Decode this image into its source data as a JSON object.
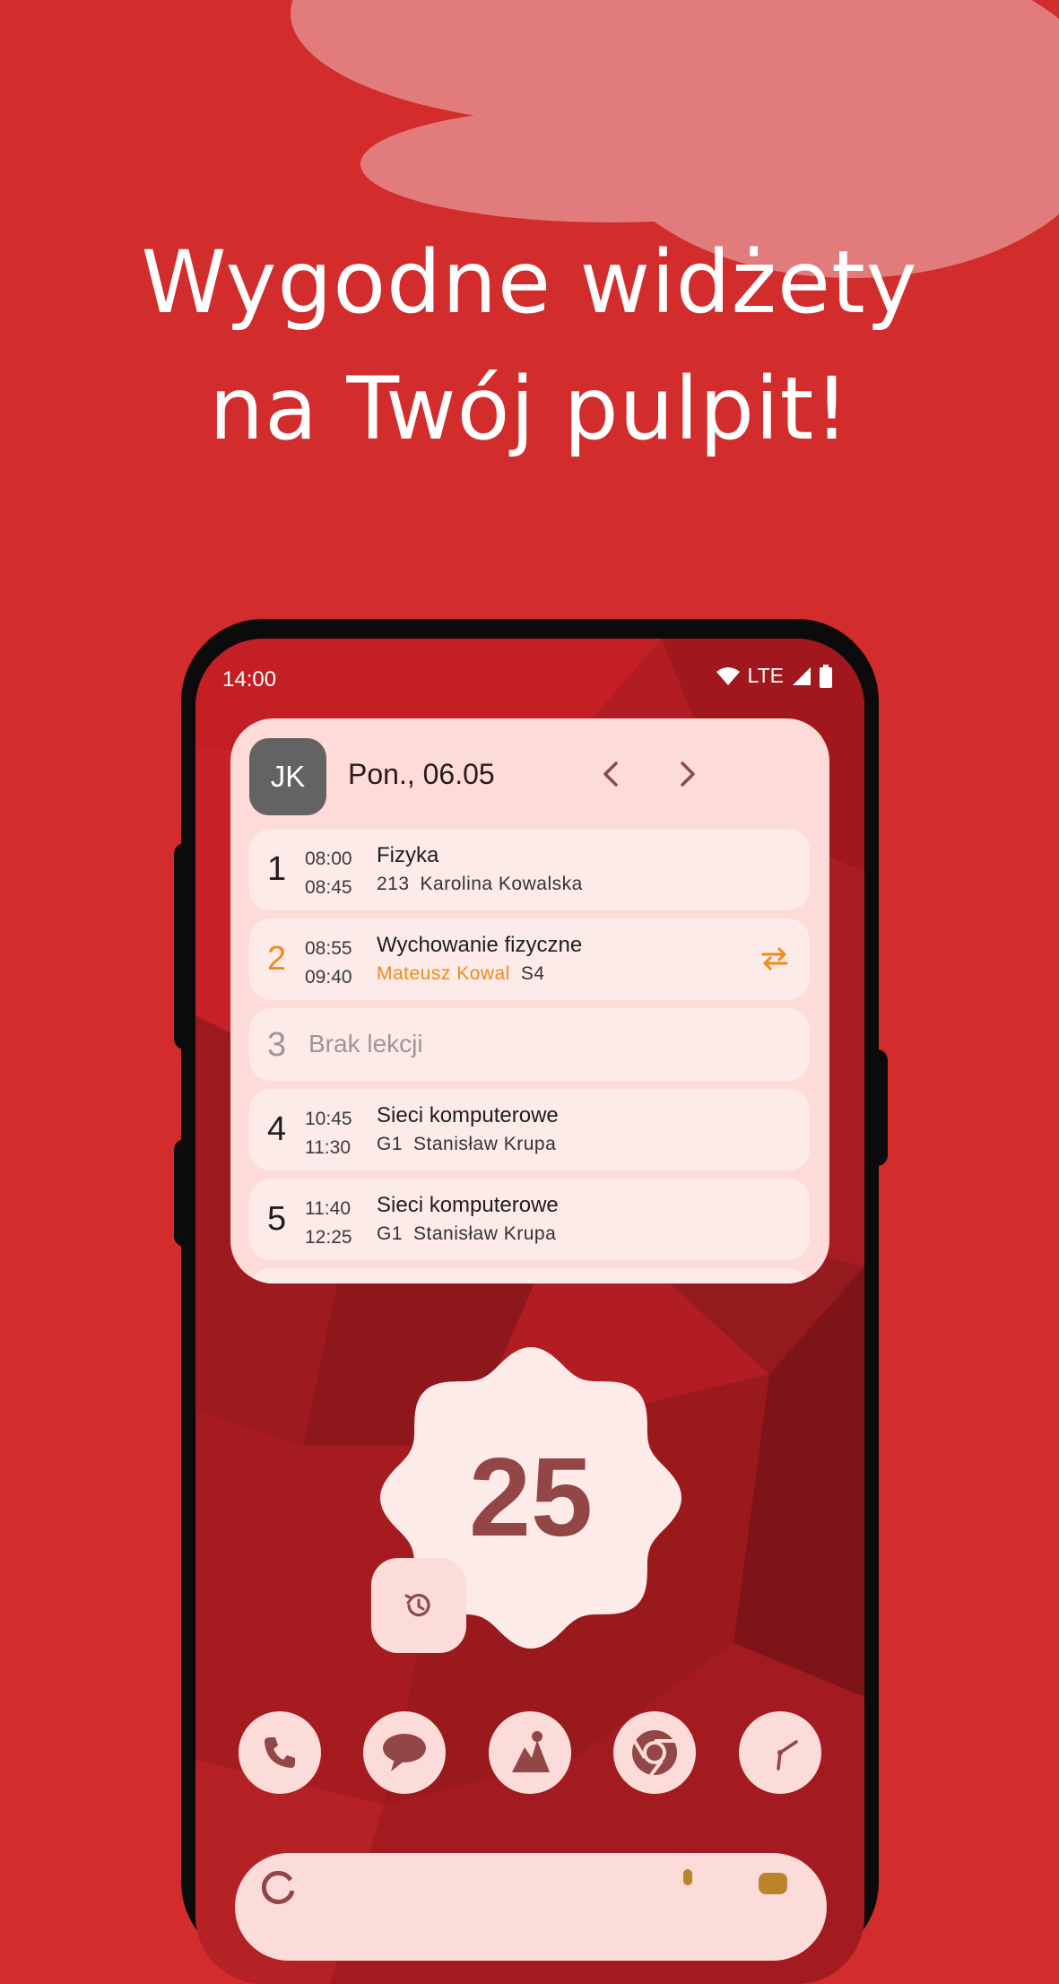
{
  "headline": {
    "line1": "Wygodne widżety",
    "line2": "na Twój pulpit!"
  },
  "status_bar": {
    "time": "14:00",
    "network": "LTE"
  },
  "timetable_widget": {
    "avatar_initials": "JK",
    "date": "Pon., 06.05",
    "lessons": [
      {
        "number": "1",
        "start": "08:00",
        "end": "08:45",
        "subject": "Fizyka",
        "room": "213",
        "teacher": "Karolina Kowalska"
      },
      {
        "number": "2",
        "start": "08:55",
        "end": "09:40",
        "subject": "Wychowanie fizyczne",
        "teacher": "Mateusz Kowal",
        "room": "S4",
        "changed": true
      },
      {
        "number": "3",
        "empty_label": "Brak lekcji"
      },
      {
        "number": "4",
        "start": "10:45",
        "end": "11:30",
        "subject": "Sieci komputerowe",
        "room": "G1",
        "teacher": "Stanisław Krupa"
      },
      {
        "number": "5",
        "start": "11:40",
        "end": "12:25",
        "subject": "Sieci komputerowe",
        "room": "G1",
        "teacher": "Stanisław Krupa"
      }
    ]
  },
  "counter_widget": {
    "value": "25"
  },
  "dock": {
    "apps": [
      "phone-icon",
      "messages-icon",
      "photos-icon",
      "chrome-icon",
      "clock-icon"
    ]
  },
  "colors": {
    "background": "#d22c2c",
    "cloud": "#e27c7c",
    "widget_bg": "#fddbd8",
    "lesson_bg": "#fdebe9",
    "accent_orange": "#f08a1c",
    "counter_text": "#934646"
  }
}
